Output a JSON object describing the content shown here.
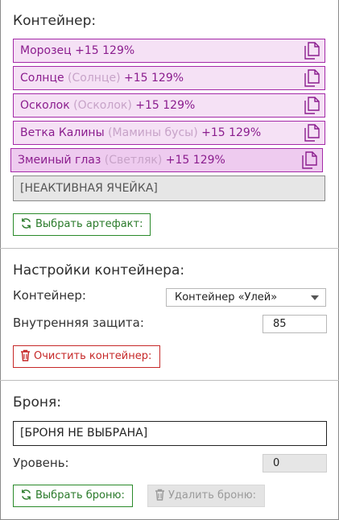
{
  "container_section": {
    "title": "Контейнер:",
    "slots": [
      {
        "name": "Морозец",
        "alt": "",
        "bonus": "+15 129%"
      },
      {
        "name": "Солнце",
        "alt": "(Солнце)",
        "bonus": "+15 129%"
      },
      {
        "name": "Осколок",
        "alt": "(Осколок)",
        "bonus": "+15 129%"
      },
      {
        "name": "Ветка Калины",
        "alt": "(Мамины бусы)",
        "bonus": "+15 129%"
      },
      {
        "name": "Змеиный глаз",
        "alt": "(Светляк)",
        "bonus": "+15 129%"
      }
    ],
    "inactive_slot": "[НЕАКТИВНАЯ ЯЧЕЙКА]",
    "choose_artifact_label": "Выбрать артефакт:"
  },
  "settings_section": {
    "title": "Настройки контейнера:",
    "container_label": "Контейнер:",
    "container_value": "Контейнер «Улей»",
    "protection_label": "Внутренняя защита:",
    "protection_value": "85",
    "clear_label": "Очистить контейнер:"
  },
  "armor_section": {
    "title": "Броня:",
    "armor_value": "[БРОНЯ НЕ ВЫБРАНА]",
    "level_label": "Уровень:",
    "level_value": "0",
    "choose_armor_label": "Выбрать броню:",
    "remove_armor_label": "Удалить броню:"
  },
  "icons": {
    "slot_icon": "document-copy-icon",
    "refresh_icon": "refresh-icon",
    "trash_icon": "trash-icon"
  },
  "colors": {
    "slot_border": "#a42aa8",
    "slot_bg": "#f5e1f5",
    "green": "#2a8a2a",
    "red": "#c62828"
  }
}
